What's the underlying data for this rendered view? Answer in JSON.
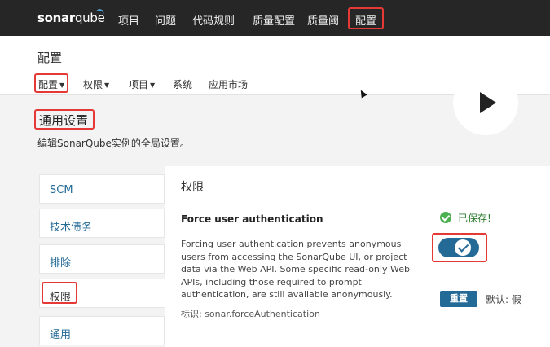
{
  "topbar": {
    "logo_text": "sonar",
    "logo_text_2": "qube",
    "nav": [
      "项目",
      "问题",
      "代码规则",
      "质量配置",
      "质量阈",
      "配置"
    ]
  },
  "header": {
    "title": "配置",
    "subnav": [
      "配置",
      "权限",
      "项目",
      "系统",
      "应用市场"
    ]
  },
  "section": {
    "title": "通用设置",
    "description": "编辑SonarQube实例的全局设置。"
  },
  "sidebar": {
    "items": [
      "SCM",
      "技术债务",
      "排除",
      "权限",
      "通用"
    ]
  },
  "panel": {
    "title": "权限",
    "setting_name": "Force user authentication",
    "setting_description": "Forcing user authentication prevents anonymous users from accessing the SonarQube UI, or project data via the Web API. Some specific read-only Web APIs, including those required to prompt authentication, are still available anonymously.",
    "setting_key": "标识: sonar.forceAuthentication",
    "saved_text": "已保存!",
    "toggle_on": true,
    "reset_label": "重置",
    "default_text": "默认: 假"
  },
  "colors": {
    "topbar": "#262626",
    "accent": "#236a97",
    "highlight": "#e53935",
    "success": "#4caf50"
  },
  "icons": [
    "play-icon",
    "check-circle-icon",
    "toggle-check-icon",
    "caret-down-icon",
    "cursor-icon"
  ]
}
